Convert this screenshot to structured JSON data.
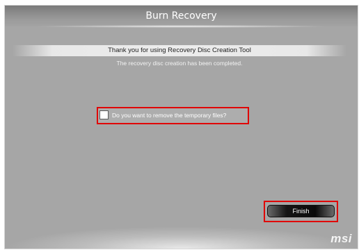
{
  "window": {
    "title": "Burn Recovery"
  },
  "main": {
    "heading": "Thank you for using Recovery Disc Creation Tool",
    "subheading": "The recovery disc creation has been completed.",
    "remove_temp_checkbox": {
      "label": "Do you want to remove the temporary files?",
      "checked": false
    },
    "finish_label": "Finish"
  },
  "footer": {
    "brand": "msi"
  },
  "colors": {
    "highlight": "#e00000",
    "background": "#a6a6a6"
  }
}
